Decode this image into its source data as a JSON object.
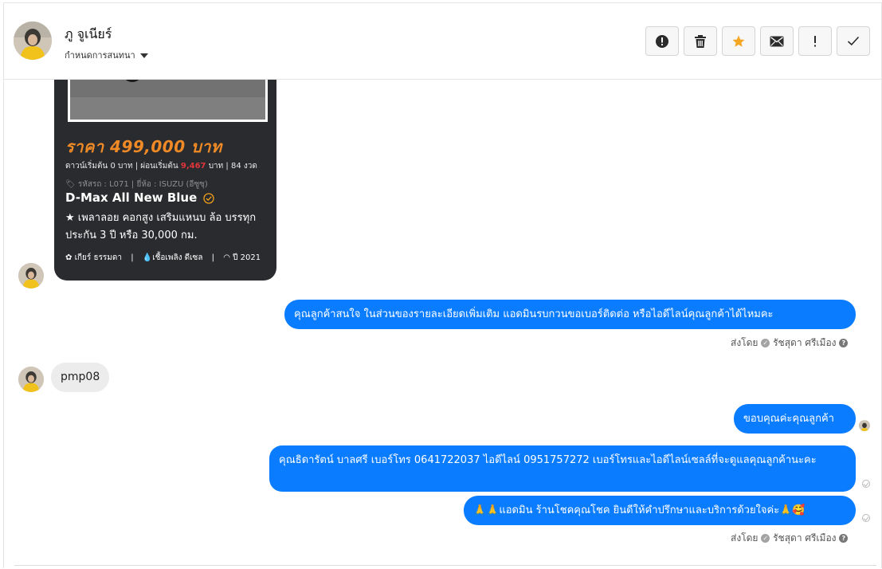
{
  "header": {
    "contact_name": "ภู จูเนียร์",
    "conversation_setting": "กำหนดการสนทนา",
    "buttons": [
      {
        "name": "report-button",
        "icon": "alert-circle-icon"
      },
      {
        "name": "delete-button",
        "icon": "trash-icon"
      },
      {
        "name": "star-button",
        "icon": "star-icon"
      },
      {
        "name": "mark-unread-button",
        "icon": "envelope-icon"
      },
      {
        "name": "important-button",
        "icon": "exclamation-icon"
      },
      {
        "name": "done-button",
        "icon": "check-icon"
      }
    ],
    "star_color": "#f5a623"
  },
  "listing_card": {
    "price": "ราคา 499,000 บาท",
    "down_payment": "ดาวน์เริ่มต้น 0 บาท | ผ่อนเริ่มต้น",
    "installment": "9,467",
    "installment_suffix": "บาท | 84 งวด",
    "code_brand": "รหัสรถ : L071 | ยี่ห้อ : ISUZU (อีซูซุ)",
    "model": "D-Max All New Blue",
    "features": "★ เพลาลอย คอกสูง เสริมแหนบ ล้อ บรรทุก ประกัน 3 ปี หรือ 30,000 กม.",
    "spec_gear": "เกียร์ ธรรมดา",
    "spec_fuel": "เชื้อเพลิง ดีเซล",
    "spec_year": "ปี 2021",
    "price_color": "#f08a26"
  },
  "messages": {
    "m1": "คุณลูกค้าสนใจ ในส่วนของรายละเอียดเพิ่มเติม แอดมินรบกวนขอเบอร์ติดต่อ หรือไอดีไลน์คุณลูกค้าได้ไหมคะ",
    "sent_by_1_prefix": "ส่งโดย",
    "sent_by_1_name": "รัชสุดา ศรีเมือง",
    "m2": "pmp08",
    "m3": "ขอบคุณค่ะคุณลูกค้า",
    "m4": "คุณธิดารัตน์ บาลศรี เบอร์โทร 0641722037  ไอดีไลน์ 0951757272  เบอร์โทรและไอดีไลน์เซลล์ที่จะดูแลคุณลูกค้านะคะ",
    "m5": "🙏🙏แอดมิน ร้านโชคคุณโชค ยินดีให้คำปรึกษาและบริการด้วยใจค่ะ🙏🥰",
    "sent_by_2_prefix": "ส่งโดย",
    "sent_by_2_name": "รัชสุดา ศรีเมือง",
    "outgoing_color": "#0a7cff"
  }
}
